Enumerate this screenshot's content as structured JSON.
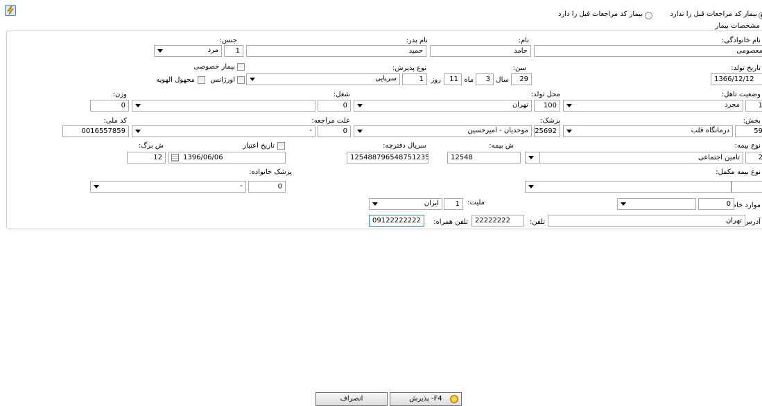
{
  "toolbar": {
    "icon": "lightning-icon"
  },
  "patient_mode": {
    "no_history_label": "بیمار کد مراجعات قبل را ندارد",
    "has_history_label": "بیمار کد مراجعات قبل را دارد",
    "selected": "no_history"
  },
  "section_title": "مشخصات بیمار",
  "labels": {
    "last_name": "نام خانوادگی:",
    "first_name": "نام:",
    "father_name": "نام پدر:",
    "gender": "جنس:",
    "birth_date": "تاریخ تولد:",
    "age": "سن:",
    "admission_type": "نوع پذیرش:",
    "private_patient": "بیمار خصوصی",
    "emergency": "اورژانس",
    "unknown_identity": "مجهول الهویه",
    "marital_status": "وضعیت تاهل:",
    "birth_place": "محل تولد:",
    "job": "شغل:",
    "weight": "وزن:",
    "ward": "بخش:",
    "doctor": "پزشک:",
    "visit_reason": "علت مراجعه:",
    "national_id": "کد ملی:",
    "insurance_type": "نوع بیمه:",
    "insurance_number": "ش بیمه:",
    "booklet_serial": "سریال دفترچه:",
    "validity_date": "تاریخ اعتبار",
    "sheet_number": "ش برگ:",
    "supp_insurance": "نوع بیمه مکمل:",
    "family_doctor": "پزشک خانواده:",
    "special_cases": "موارد خاص:",
    "nationality": "ملیت:",
    "address": "آدرس:",
    "phone": "تلفن:",
    "mobile": "تلفن همراه:",
    "year": "سال",
    "month": "ماه",
    "day": "روز"
  },
  "values": {
    "last_name": "معصومی",
    "first_name": "حامد",
    "father_name": "حمید",
    "gender_code": "1",
    "gender": "مرد",
    "birth_date": "1366/12/12",
    "age_years": "29",
    "age_months": "3",
    "age_days": "11",
    "admission_code": "1",
    "admission": "سرپایی",
    "marital_code": "1",
    "marital": "مجرد",
    "birth_place_code": "100",
    "birth_place": "تهران",
    "job_code": "0",
    "job": "",
    "weight": "0",
    "ward_code": "59",
    "ward": "درمانگاه قلب",
    "doctor_code": "25692",
    "doctor": "موحدیان - امیرحسین",
    "visit_reason_code": "0",
    "visit_reason": "-",
    "national_id": "0016557859",
    "insurance_code": "2",
    "insurance": "تامین اجتماعی",
    "insurance_number": "12548",
    "booklet_serial": "125488796548751235",
    "validity_date": "1396/06/06",
    "sheet_number": "12",
    "supp_insurance_code": "",
    "supp_insurance": "",
    "family_doctor_code": "0",
    "family_doctor": "-",
    "special_cases_code": "0",
    "special_cases": "",
    "nationality_code": "1",
    "nationality": "ایران",
    "address": "تهران",
    "phone": "22222222",
    "mobile": "09122222222"
  },
  "buttons": {
    "admit": "F4- پذیرش",
    "cancel": "انصراف"
  }
}
